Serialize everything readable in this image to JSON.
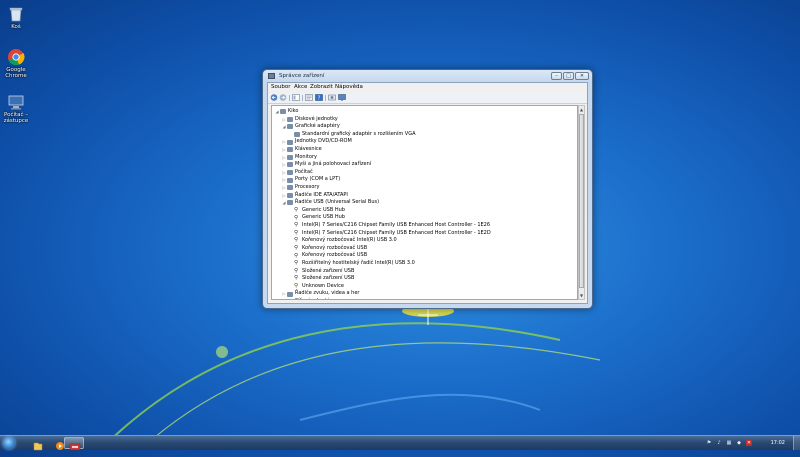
{
  "desktop": {
    "icons": [
      {
        "label": "Koš",
        "icon": "recycle-bin-icon"
      },
      {
        "label": "Google Chrome",
        "icon": "chrome-icon"
      },
      {
        "label": "Počítač – zástupce",
        "icon": "computer-icon"
      }
    ]
  },
  "window": {
    "title": "Správce zařízení",
    "controls": {
      "minimize": "–",
      "maximize": "□",
      "close": "✕"
    },
    "menu": [
      "Soubor",
      "Akce",
      "Zobrazit",
      "Nápověda"
    ],
    "toolbar_icons": [
      "back-arrow-icon",
      "forward-arrow-icon",
      "tree-view-icon",
      "properties-icon",
      "help-icon",
      "scan-hardware-icon",
      "display-icon"
    ],
    "tree": [
      {
        "label": "Kiko",
        "level": 0,
        "expander": "◢"
      },
      {
        "label": "Diskové jednotky",
        "level": 1,
        "expander": "▷"
      },
      {
        "label": "Grafické adaptéry",
        "level": 1,
        "expander": "◢"
      },
      {
        "label": "Standardní grafický adaptér s rozlišením VGA",
        "level": 2,
        "expander": ""
      },
      {
        "label": "Jednotky DVD/CD-ROM",
        "level": 1,
        "expander": "▷"
      },
      {
        "label": "Klávesnice",
        "level": 1,
        "expander": "▷"
      },
      {
        "label": "Monitory",
        "level": 1,
        "expander": "▷"
      },
      {
        "label": "Myši a jiná polohovací zařízení",
        "level": 1,
        "expander": "▷"
      },
      {
        "label": "Počítač",
        "level": 1,
        "expander": "▷"
      },
      {
        "label": "Porty (COM a LPT)",
        "level": 1,
        "expander": "▷"
      },
      {
        "label": "Procesory",
        "level": 1,
        "expander": "▷"
      },
      {
        "label": "Řadiče IDE ATA/ATAPI",
        "level": 1,
        "expander": "▷"
      },
      {
        "label": "Řadiče USB (Universal Serial Bus)",
        "level": 1,
        "expander": "◢"
      },
      {
        "label": "Generic USB Hub",
        "level": 2,
        "expander": ""
      },
      {
        "label": "Generic USB Hub",
        "level": 2,
        "expander": ""
      },
      {
        "label": "Intel(R) 7 Series/C216 Chipset Family USB Enhanced Host Controller - 1E26",
        "level": 2,
        "expander": ""
      },
      {
        "label": "Intel(R) 7 Series/C216 Chipset Family USB Enhanced Host Controller - 1E2D",
        "level": 2,
        "expander": ""
      },
      {
        "label": "Kořenový rozbočovač Intel(R) USB 3.0",
        "level": 2,
        "expander": ""
      },
      {
        "label": "Kořenový rozbočovač USB",
        "level": 2,
        "expander": ""
      },
      {
        "label": "Kořenový rozbočovač USB",
        "level": 2,
        "expander": ""
      },
      {
        "label": "Rozšiřitelný hostitelský řadič Intel(R) USB 3.0",
        "level": 2,
        "expander": ""
      },
      {
        "label": "Složené zařízení USB",
        "level": 2,
        "expander": ""
      },
      {
        "label": "Složené zařízení USB",
        "level": 2,
        "expander": ""
      },
      {
        "label": "Unknown Device",
        "level": 2,
        "expander": ""
      },
      {
        "label": "Řadiče zvuku, videa a her",
        "level": 1,
        "expander": "▷"
      },
      {
        "label": "Síťové adaptéry",
        "level": 1,
        "expander": "▷"
      }
    ]
  },
  "taskbar": {
    "clock": "17:02",
    "tray_icons": [
      "flag-icon",
      "speaker-icon",
      "network-icon",
      "shield-icon",
      "language-icon"
    ]
  },
  "colors": {
    "accent": "#1a6cc9",
    "taskbar": "#2b4a73",
    "window_frame": "#c5d8ee"
  }
}
